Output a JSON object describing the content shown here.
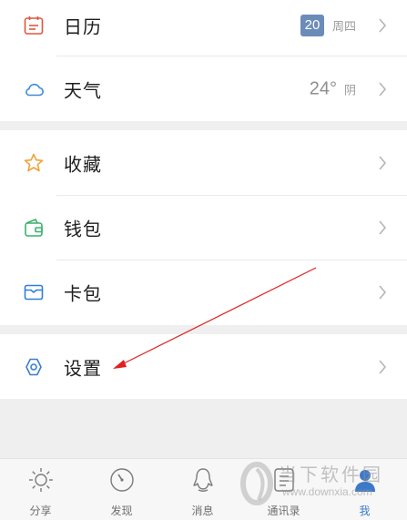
{
  "menu": {
    "calendar": {
      "label": "日历",
      "day": "20",
      "weekday": "周四"
    },
    "weather": {
      "label": "天气",
      "temperature": "24°",
      "condition": "阴"
    },
    "favorites": {
      "label": "收藏"
    },
    "wallet": {
      "label": "钱包"
    },
    "cards": {
      "label": "卡包"
    },
    "settings": {
      "label": "设置"
    }
  },
  "tabs": [
    {
      "label": "分享",
      "icon": "sun-icon",
      "active": false
    },
    {
      "label": "发现",
      "icon": "compass-icon",
      "active": false
    },
    {
      "label": "消息",
      "icon": "penguin-icon",
      "active": false
    },
    {
      "label": "通讯录",
      "icon": "contacts-icon",
      "active": false
    },
    {
      "label": "我",
      "icon": "person-icon",
      "active": true
    }
  ],
  "watermark": {
    "text": "当下软件园",
    "url": "www.downxia.com"
  },
  "colors": {
    "calendar_icon": "#e0553f",
    "weather_icon": "#3a8ad8",
    "favorites_icon": "#f0a23a",
    "wallet_icon": "#39b26b",
    "cards_icon": "#2f7fd6",
    "settings_icon": "#3a7fd0",
    "badge_bg": "#6b8cb8",
    "active_tab": "#3d79c9",
    "annotation_arrow": "#e02020"
  }
}
